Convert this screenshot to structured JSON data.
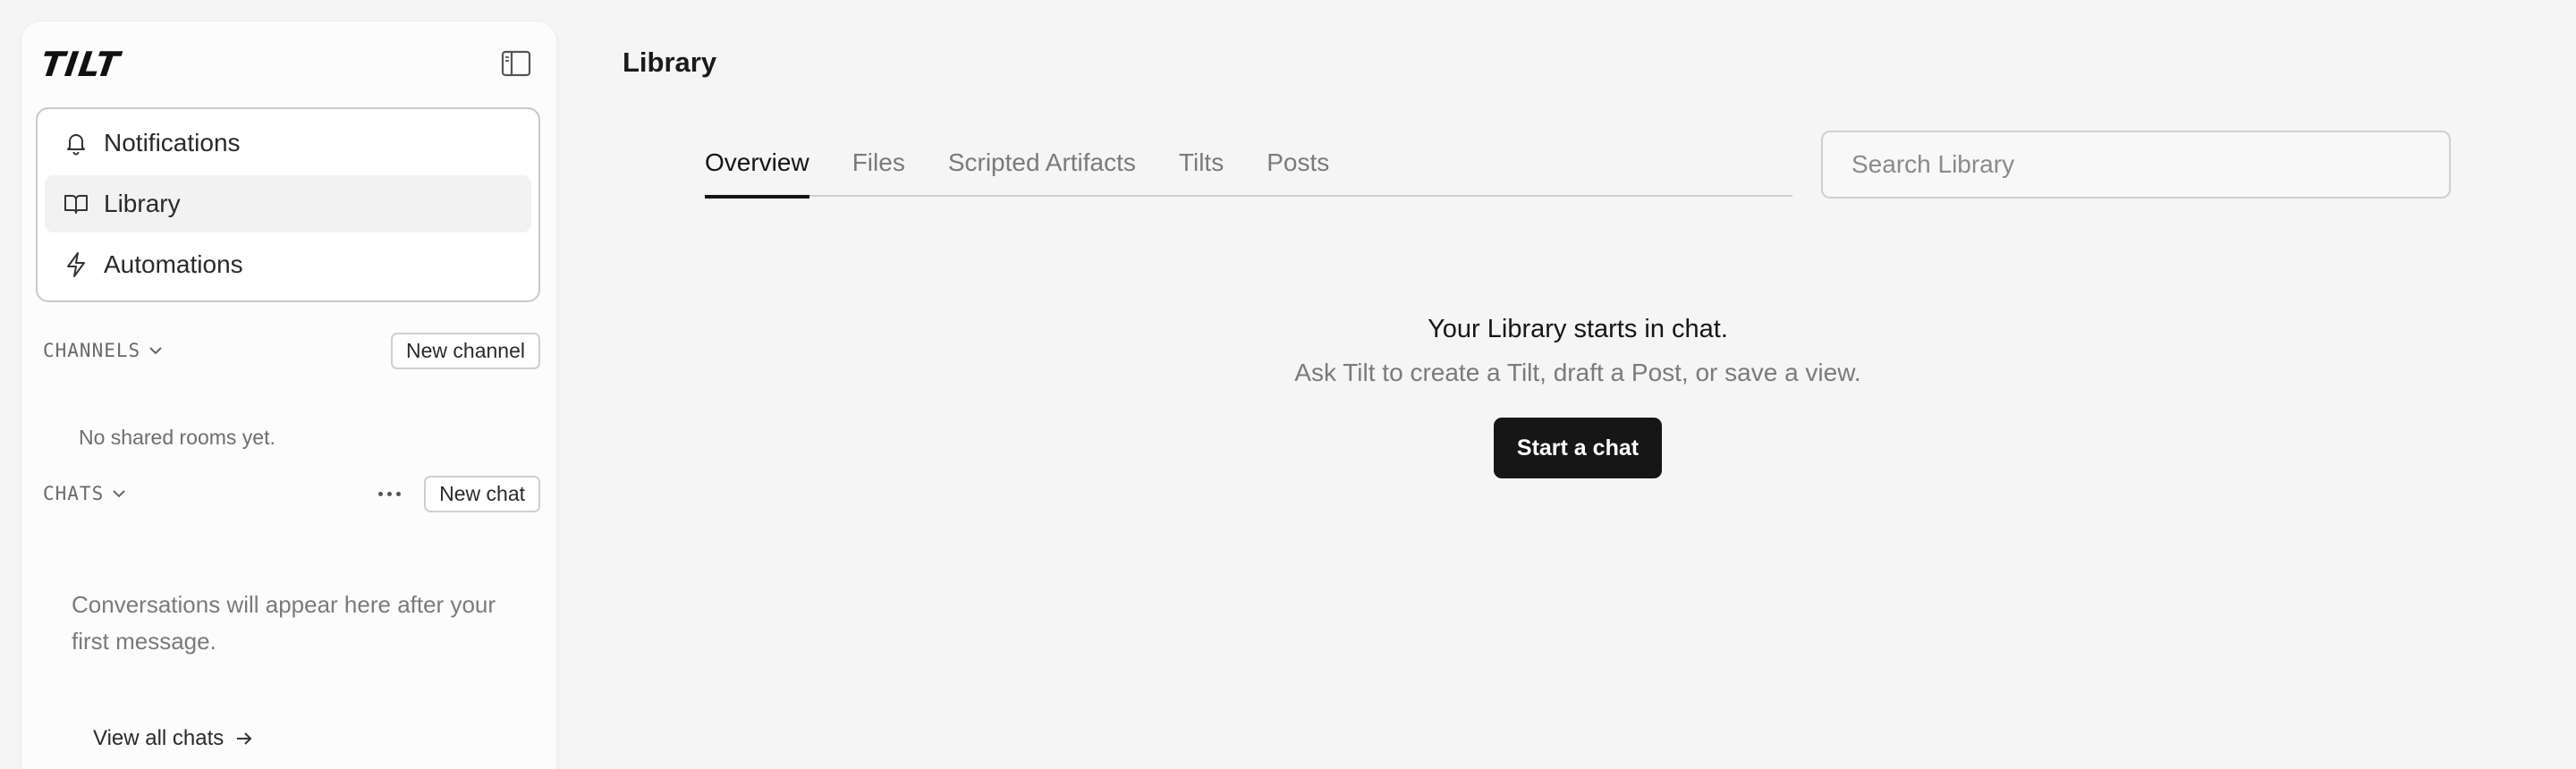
{
  "app": {
    "logo_text": "TILT"
  },
  "sidebar": {
    "nav": [
      {
        "label": "Notifications",
        "icon": "bell-icon"
      },
      {
        "label": "Library",
        "icon": "book-icon",
        "active": true
      },
      {
        "label": "Automations",
        "icon": "lightning-icon"
      }
    ],
    "channels": {
      "title": "CHANNELS",
      "new_label": "New channel",
      "empty_text": "No shared rooms yet."
    },
    "chats": {
      "title": "CHATS",
      "new_label": "New chat",
      "empty_text": "Conversations will appear here after your first message.",
      "view_all_label": "View all chats"
    }
  },
  "main": {
    "title": "Library",
    "tabs": [
      {
        "label": "Overview",
        "active": true
      },
      {
        "label": "Files"
      },
      {
        "label": "Scripted Artifacts"
      },
      {
        "label": "Tilts"
      },
      {
        "label": "Posts"
      }
    ],
    "search": {
      "placeholder": "Search Library",
      "value": ""
    },
    "empty_state": {
      "title": "Your Library starts in chat.",
      "subtitle": "Ask Tilt to create a Tilt, draft a Post, or save a view.",
      "cta_label": "Start a chat"
    }
  },
  "colors": {
    "background": "#f5f5f5",
    "sidebar": "#fcfcfc",
    "accent": "#161616",
    "muted_text": "#7a7a7a"
  }
}
